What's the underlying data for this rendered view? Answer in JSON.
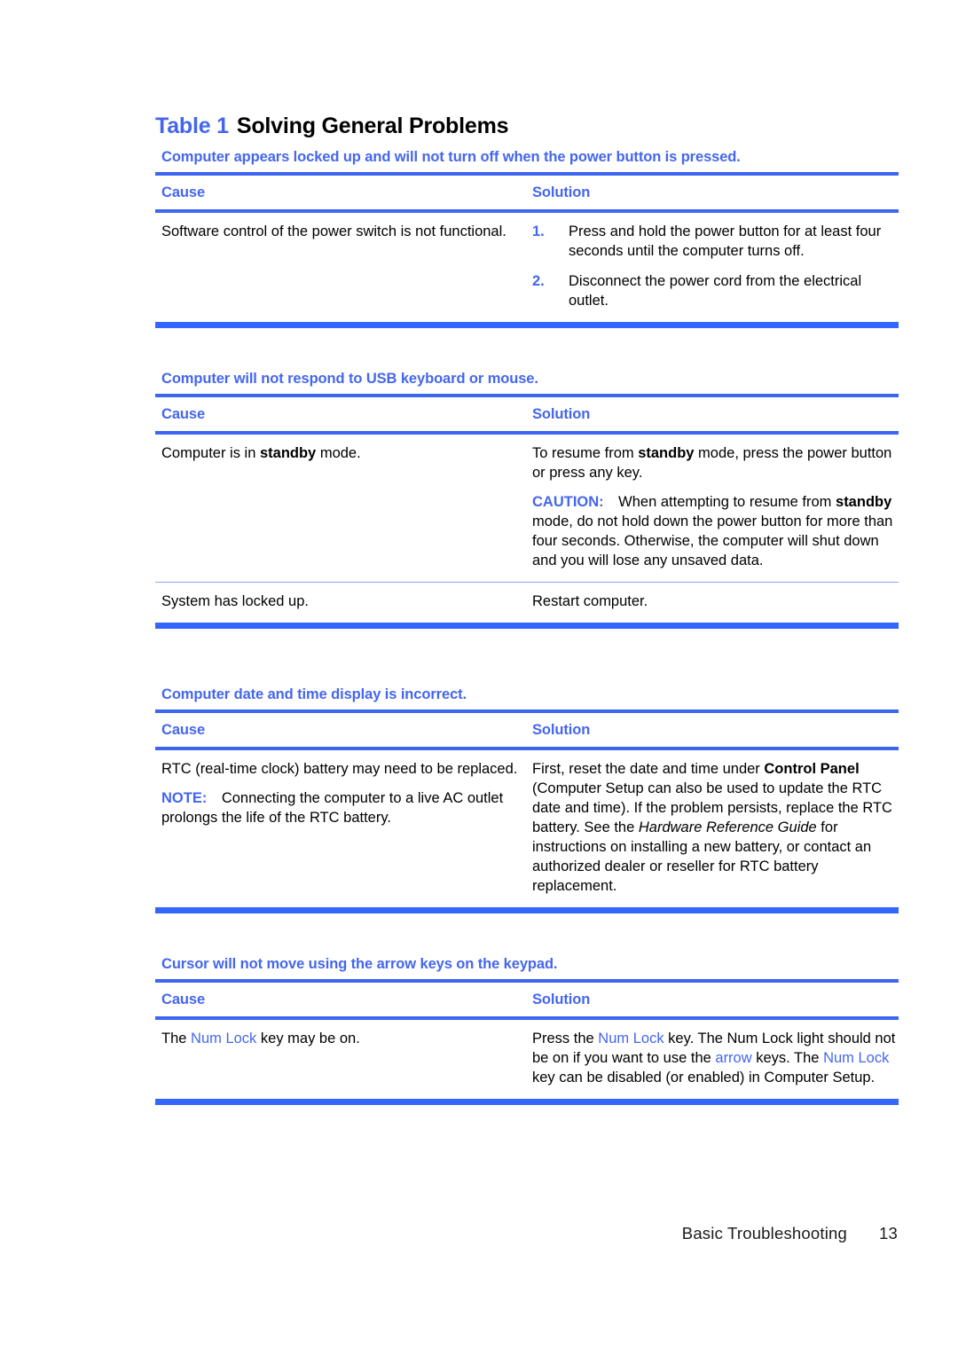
{
  "title": {
    "label": "Table 1",
    "name": "Solving General Problems"
  },
  "columns": {
    "cause": "Cause",
    "solution": "Solution"
  },
  "sections": [
    {
      "heading": "Computer appears locked up and will not turn off when the power button is pressed.",
      "rows": [
        {
          "cause": "Software control of the power switch is not functional.",
          "solution_steps": [
            {
              "num": "1.",
              "text": "Press and hold the power button for at least four seconds until the computer turns off."
            },
            {
              "num": "2.",
              "text": "Disconnect the power cord from the electrical outlet."
            }
          ]
        }
      ]
    },
    {
      "heading": "Computer will not respond to USB keyboard or mouse.",
      "rows": [
        {
          "cause_parts": [
            {
              "t": "Computer is in "
            },
            {
              "t": "standby",
              "style": "bold"
            },
            {
              "t": " mode."
            }
          ],
          "solution_parts": [
            {
              "t": "To resume from "
            },
            {
              "t": "standby",
              "style": "bold"
            },
            {
              "t": " mode, press the power button or press any key."
            }
          ],
          "solution_note": {
            "lead": "CAUTION:",
            "parts": [
              {
                "t": "When attempting to resume from "
              },
              {
                "t": "standby",
                "style": "bold"
              },
              {
                "t": " mode, do not hold down the power button for more than four seconds. Otherwise, the computer will shut down and you will lose any unsaved data."
              }
            ]
          }
        },
        {
          "cause": "System has locked up.",
          "solution": "Restart computer."
        }
      ]
    },
    {
      "heading": "Computer date and time display is incorrect.",
      "rows": [
        {
          "cause": "RTC (real-time clock) battery may need to be replaced.",
          "cause_note": {
            "lead": "NOTE:",
            "parts": [
              {
                "t": "Connecting the computer to a live AC outlet prolongs the life of the RTC battery."
              }
            ]
          },
          "solution_parts": [
            {
              "t": "First, reset the date and time under "
            },
            {
              "t": "Control Panel",
              "style": "bold"
            },
            {
              "t": " (Computer Setup can also be used to update the RTC date and time). If the problem persists, replace the RTC battery. See the "
            },
            {
              "t": "Hardware Reference Guide",
              "style": "italic"
            },
            {
              "t": " for instructions on installing a new battery, or contact an authorized dealer or reseller for RTC battery replacement."
            }
          ]
        }
      ]
    },
    {
      "heading": "Cursor will not move using the arrow keys on the keypad.",
      "rows": [
        {
          "cause_parts": [
            {
              "t": "The "
            },
            {
              "t": "Num Lock",
              "style": "link"
            },
            {
              "t": " key may be on."
            }
          ],
          "solution_parts": [
            {
              "t": "Press the "
            },
            {
              "t": "Num Lock",
              "style": "link"
            },
            {
              "t": " key. The Num Lock light should not be on if you want to use the "
            },
            {
              "t": "arrow",
              "style": "link"
            },
            {
              "t": " keys. The "
            },
            {
              "t": "Num Lock",
              "style": "link"
            },
            {
              "t": " key can be disabled (or enabled) in Computer Setup."
            }
          ]
        }
      ]
    }
  ],
  "footer": {
    "chapter": "Basic Troubleshooting",
    "page_number": "13"
  },
  "colors": {
    "heading_blue": "#4466EE",
    "rule_blue": "#3366FF",
    "rule_thin_blue": "#3D66F0",
    "hairline_blue": "#8FA8F5"
  }
}
